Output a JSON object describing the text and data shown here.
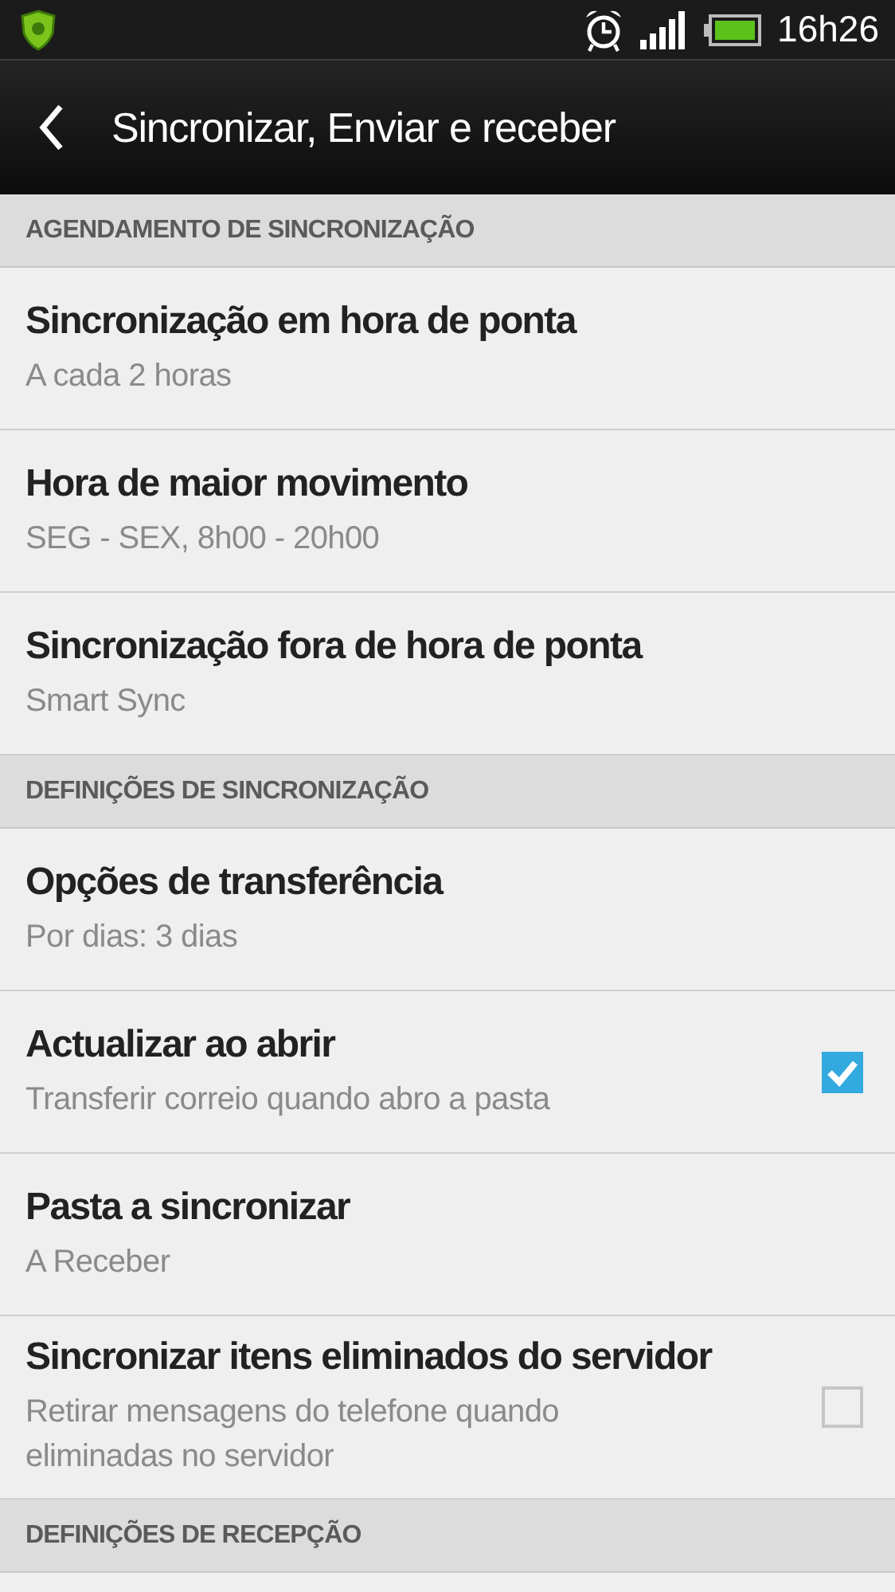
{
  "status_bar": {
    "time": "16h26"
  },
  "action_bar": {
    "title": "Sincronizar, Enviar e receber"
  },
  "sections": [
    {
      "header": "AGENDAMENTO DE SINCRONIZAÇÃO",
      "items": [
        {
          "kind": "text",
          "title": "Sincronização em hora de ponta",
          "summary": "A cada 2 horas"
        },
        {
          "kind": "text",
          "title": "Hora de maior movimento",
          "summary": "SEG - SEX, 8h00 - 20h00"
        },
        {
          "kind": "text",
          "title": "Sincronização fora de hora de ponta",
          "summary": "Smart Sync"
        }
      ]
    },
    {
      "header": "DEFINIÇÕES DE SINCRONIZAÇÃO",
      "items": [
        {
          "kind": "text",
          "title": "Opções de transferência",
          "summary": "Por dias: 3 dias"
        },
        {
          "kind": "checkbox",
          "title": "Actualizar ao abrir",
          "summary": "Transferir correio quando abro a pasta",
          "checked": true
        },
        {
          "kind": "text",
          "title": "Pasta a sincronizar",
          "summary": "A Receber"
        },
        {
          "kind": "checkbox",
          "title": "Sincronizar itens eliminados do servidor",
          "summary": "Retirar mensagens do telefone quando eliminadas no servidor",
          "checked": false
        }
      ]
    },
    {
      "header": "DEFINIÇÕES DE RECEPÇÃO"
    }
  ]
}
